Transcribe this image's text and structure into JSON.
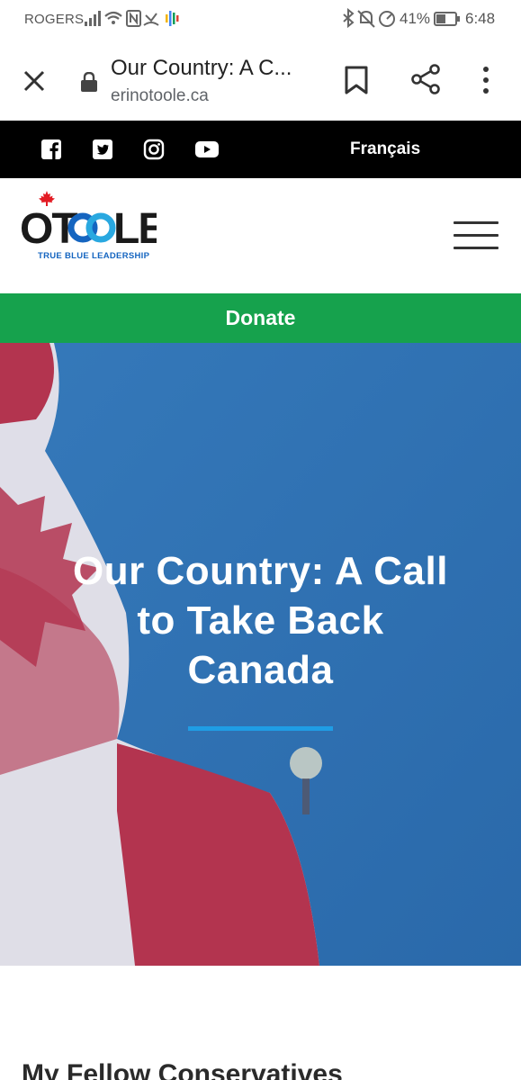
{
  "status_bar": {
    "carrier": "ROGERS",
    "battery_percent": "41%",
    "time": "6:48"
  },
  "browser": {
    "page_title": "Our Country: A C...",
    "url": "erinotoole.ca",
    "icons": [
      "close-icon",
      "lock-icon",
      "bookmark-icon",
      "share-icon",
      "more-vert-icon"
    ]
  },
  "social_bar": {
    "icons": [
      "facebook-icon",
      "twitter-icon",
      "instagram-icon",
      "youtube-icon"
    ],
    "language_link": "Français"
  },
  "header": {
    "logo_text": "OTOOLE",
    "logo_tagline": "TRUE BLUE LEADERSHIP",
    "menu_icon": "hamburger-menu-icon"
  },
  "donate": {
    "label": "Donate",
    "color": "#16a24d"
  },
  "hero": {
    "title_line1": "Our Country: A Call",
    "title_line2": "to Take Back",
    "title_line3": "Canada",
    "accent_color": "#1f9de5"
  },
  "content": {
    "heading": "My Fellow Conservatives"
  }
}
